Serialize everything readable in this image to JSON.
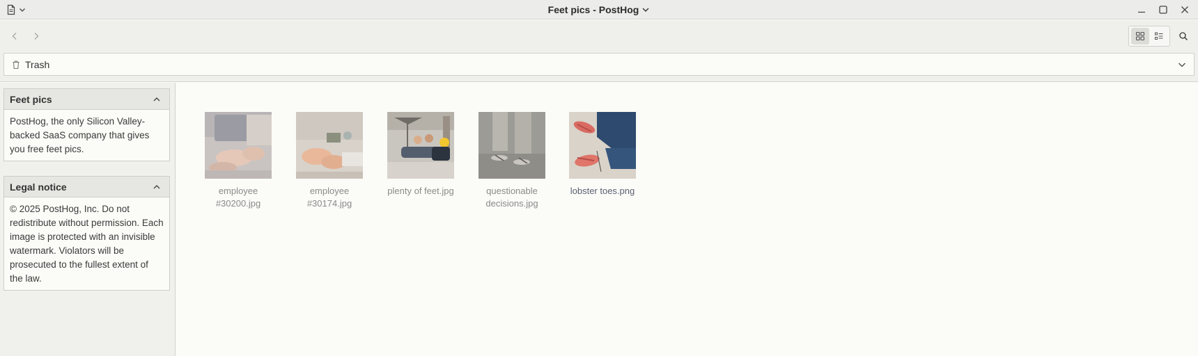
{
  "window": {
    "title": "Feet pics - PostHog",
    "controls": {
      "minimize_icon": "minimize-icon",
      "maximize_icon": "maximize-icon",
      "close_icon": "close-icon"
    }
  },
  "toolbar": {
    "back_icon": "chevron-left-icon",
    "forward_icon": "chevron-right-icon",
    "view_modes": [
      "grid",
      "list"
    ],
    "active_view": "grid",
    "search_icon": "search-icon"
  },
  "pathbar": {
    "label": "Trash",
    "icon": "trash-icon"
  },
  "sidebar": {
    "panels": [
      {
        "title": "Feet pics",
        "body": "PostHog, the only Silicon Valley-backed SaaS company that gives you free feet pics."
      },
      {
        "title": "Legal notice",
        "body": "© 2025 PostHog, Inc. Do not redistribute without permission. Each image is protected with an invisible watermark. Violators will be prosecuted to the fullest extent of the law."
      }
    ]
  },
  "files": [
    {
      "name": "employee #30200.jpg",
      "selected": false
    },
    {
      "name": "employee #30174.jpg",
      "selected": false
    },
    {
      "name": "plenty of feet.jpg",
      "selected": false
    },
    {
      "name": "questionable decisions.jpg",
      "selected": false
    },
    {
      "name": "lobster toes.png",
      "selected": true
    }
  ],
  "colors": {
    "background": "#fbfbf8",
    "chrome": "#efefec",
    "accent_text": "#5a6270"
  }
}
